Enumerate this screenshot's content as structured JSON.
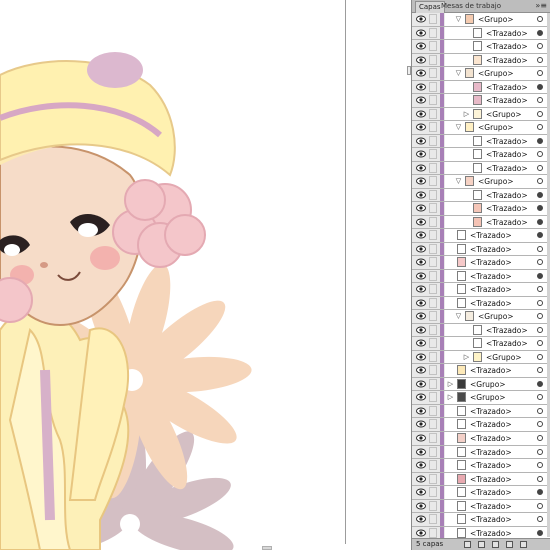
{
  "panel": {
    "tabs": [
      {
        "label": "Capas",
        "active": true
      },
      {
        "label": "Mesas de trabajo",
        "active": false
      }
    ],
    "menu_icon": "panel-menu-icon",
    "layer_count": "5 capas",
    "layers": [
      {
        "label": "<Grupo>",
        "indent": 1,
        "expanded": true,
        "thumb": "#f5cbb0",
        "target": "empty"
      },
      {
        "label": "<Trazado>",
        "indent": 2,
        "thumb": "#ffffff",
        "target": "filled"
      },
      {
        "label": "<Trazado>",
        "indent": 2,
        "thumb": "#ffffff",
        "target": "empty"
      },
      {
        "label": "<Trazado>",
        "indent": 2,
        "thumb": "#fce6d0",
        "target": "empty"
      },
      {
        "label": "<Grupo>",
        "indent": 1,
        "expanded": true,
        "thumb": "#f3e3d0",
        "target": "empty"
      },
      {
        "label": "<Trazado>",
        "indent": 2,
        "thumb": "#e8b9c9",
        "target": "filled"
      },
      {
        "label": "<Trazado>",
        "indent": 2,
        "thumb": "#e8bac8",
        "target": "empty"
      },
      {
        "label": "<Grupo>",
        "indent": 2,
        "expanded": false,
        "thumb": "#fdf4d8",
        "target": "empty"
      },
      {
        "label": "<Grupo>",
        "indent": 1,
        "expanded": true,
        "thumb": "#fff0c4",
        "target": "empty"
      },
      {
        "label": "<Trazado>",
        "indent": 2,
        "thumb": "#ffffff",
        "target": "filled"
      },
      {
        "label": "<Trazado>",
        "indent": 2,
        "thumb": "#ffffff",
        "target": "empty"
      },
      {
        "label": "<Trazado>",
        "indent": 2,
        "thumb": "#ffffff",
        "target": "empty"
      },
      {
        "label": "<Grupo>",
        "indent": 1,
        "expanded": true,
        "thumb": "#f6d2c4",
        "target": "empty"
      },
      {
        "label": "<Trazado>",
        "indent": 2,
        "thumb": "#ffffff",
        "target": "filled"
      },
      {
        "label": "<Trazado>",
        "indent": 2,
        "thumb": "#f5c6b8",
        "target": "filled"
      },
      {
        "label": "<Trazado>",
        "indent": 2,
        "thumb": "#f5c3b5",
        "target": "filled"
      },
      {
        "label": "<Trazado>",
        "indent": 0,
        "thumb": "#ffffff",
        "target": "filled"
      },
      {
        "label": "<Trazado>",
        "indent": 0,
        "thumb": "#ffffff",
        "target": "empty"
      },
      {
        "label": "<Trazado>",
        "indent": 0,
        "thumb": "#f6c9c9",
        "target": "empty"
      },
      {
        "label": "<Trazado>",
        "indent": 0,
        "thumb": "#ffffff",
        "target": "filled"
      },
      {
        "label": "<Trazado>",
        "indent": 0,
        "thumb": "#ffffff",
        "target": "empty"
      },
      {
        "label": "<Trazado>",
        "indent": 0,
        "thumb": "#ffffff",
        "target": "empty"
      },
      {
        "label": "<Grupo>",
        "indent": 1,
        "expanded": true,
        "thumb": "#f5ede0",
        "target": "empty"
      },
      {
        "label": "<Trazado>",
        "indent": 2,
        "thumb": "#ffffff",
        "target": "empty"
      },
      {
        "label": "<Trazado>",
        "indent": 2,
        "thumb": "#ffffff",
        "target": "empty"
      },
      {
        "label": "<Grupo>",
        "indent": 2,
        "expanded": false,
        "thumb": "#fff4c8",
        "target": "empty"
      },
      {
        "label": "<Trazado>",
        "indent": 0,
        "thumb": "#fde9b8",
        "target": "empty"
      },
      {
        "label": "<Grupo>",
        "indent": 0,
        "expanded": false,
        "thumb": "#3a3a3a",
        "target": "filled"
      },
      {
        "label": "<Grupo>",
        "indent": 0,
        "expanded": false,
        "thumb": "#4a4a4a",
        "target": "empty"
      },
      {
        "label": "<Trazado>",
        "indent": 0,
        "thumb": "#ffffff",
        "target": "empty"
      },
      {
        "label": "<Trazado>",
        "indent": 0,
        "thumb": "#ffffff",
        "target": "empty"
      },
      {
        "label": "<Trazado>",
        "indent": 0,
        "thumb": "#f3d0c8",
        "target": "empty"
      },
      {
        "label": "<Trazado>",
        "indent": 0,
        "thumb": "#ffffff",
        "target": "empty"
      },
      {
        "label": "<Trazado>",
        "indent": 0,
        "thumb": "#ffffff",
        "target": "empty"
      },
      {
        "label": "<Trazado>",
        "indent": 0,
        "thumb": "#e8a9b0",
        "target": "empty"
      },
      {
        "label": "<Trazado>",
        "indent": 0,
        "thumb": "#ffffff",
        "target": "filled"
      },
      {
        "label": "<Trazado>",
        "indent": 0,
        "thumb": "#ffffff",
        "target": "empty"
      },
      {
        "label": "<Trazado>",
        "indent": 0,
        "thumb": "#ffffff",
        "target": "empty"
      },
      {
        "label": "<Trazado>",
        "indent": 0,
        "thumb": "#ffffff",
        "target": "filled"
      }
    ],
    "layer_color": "#a77fb6"
  },
  "colors": {
    "hat": "#fff2b0",
    "hat_shade": "#fbe59a",
    "skin": "#f6dcc6",
    "blush": "#f3b2ae",
    "earmuff": "#f5c9cc",
    "outline": "#caa56f",
    "flower_peach": "#f5d2b5",
    "flower_mauve": "#d2bcc2"
  }
}
